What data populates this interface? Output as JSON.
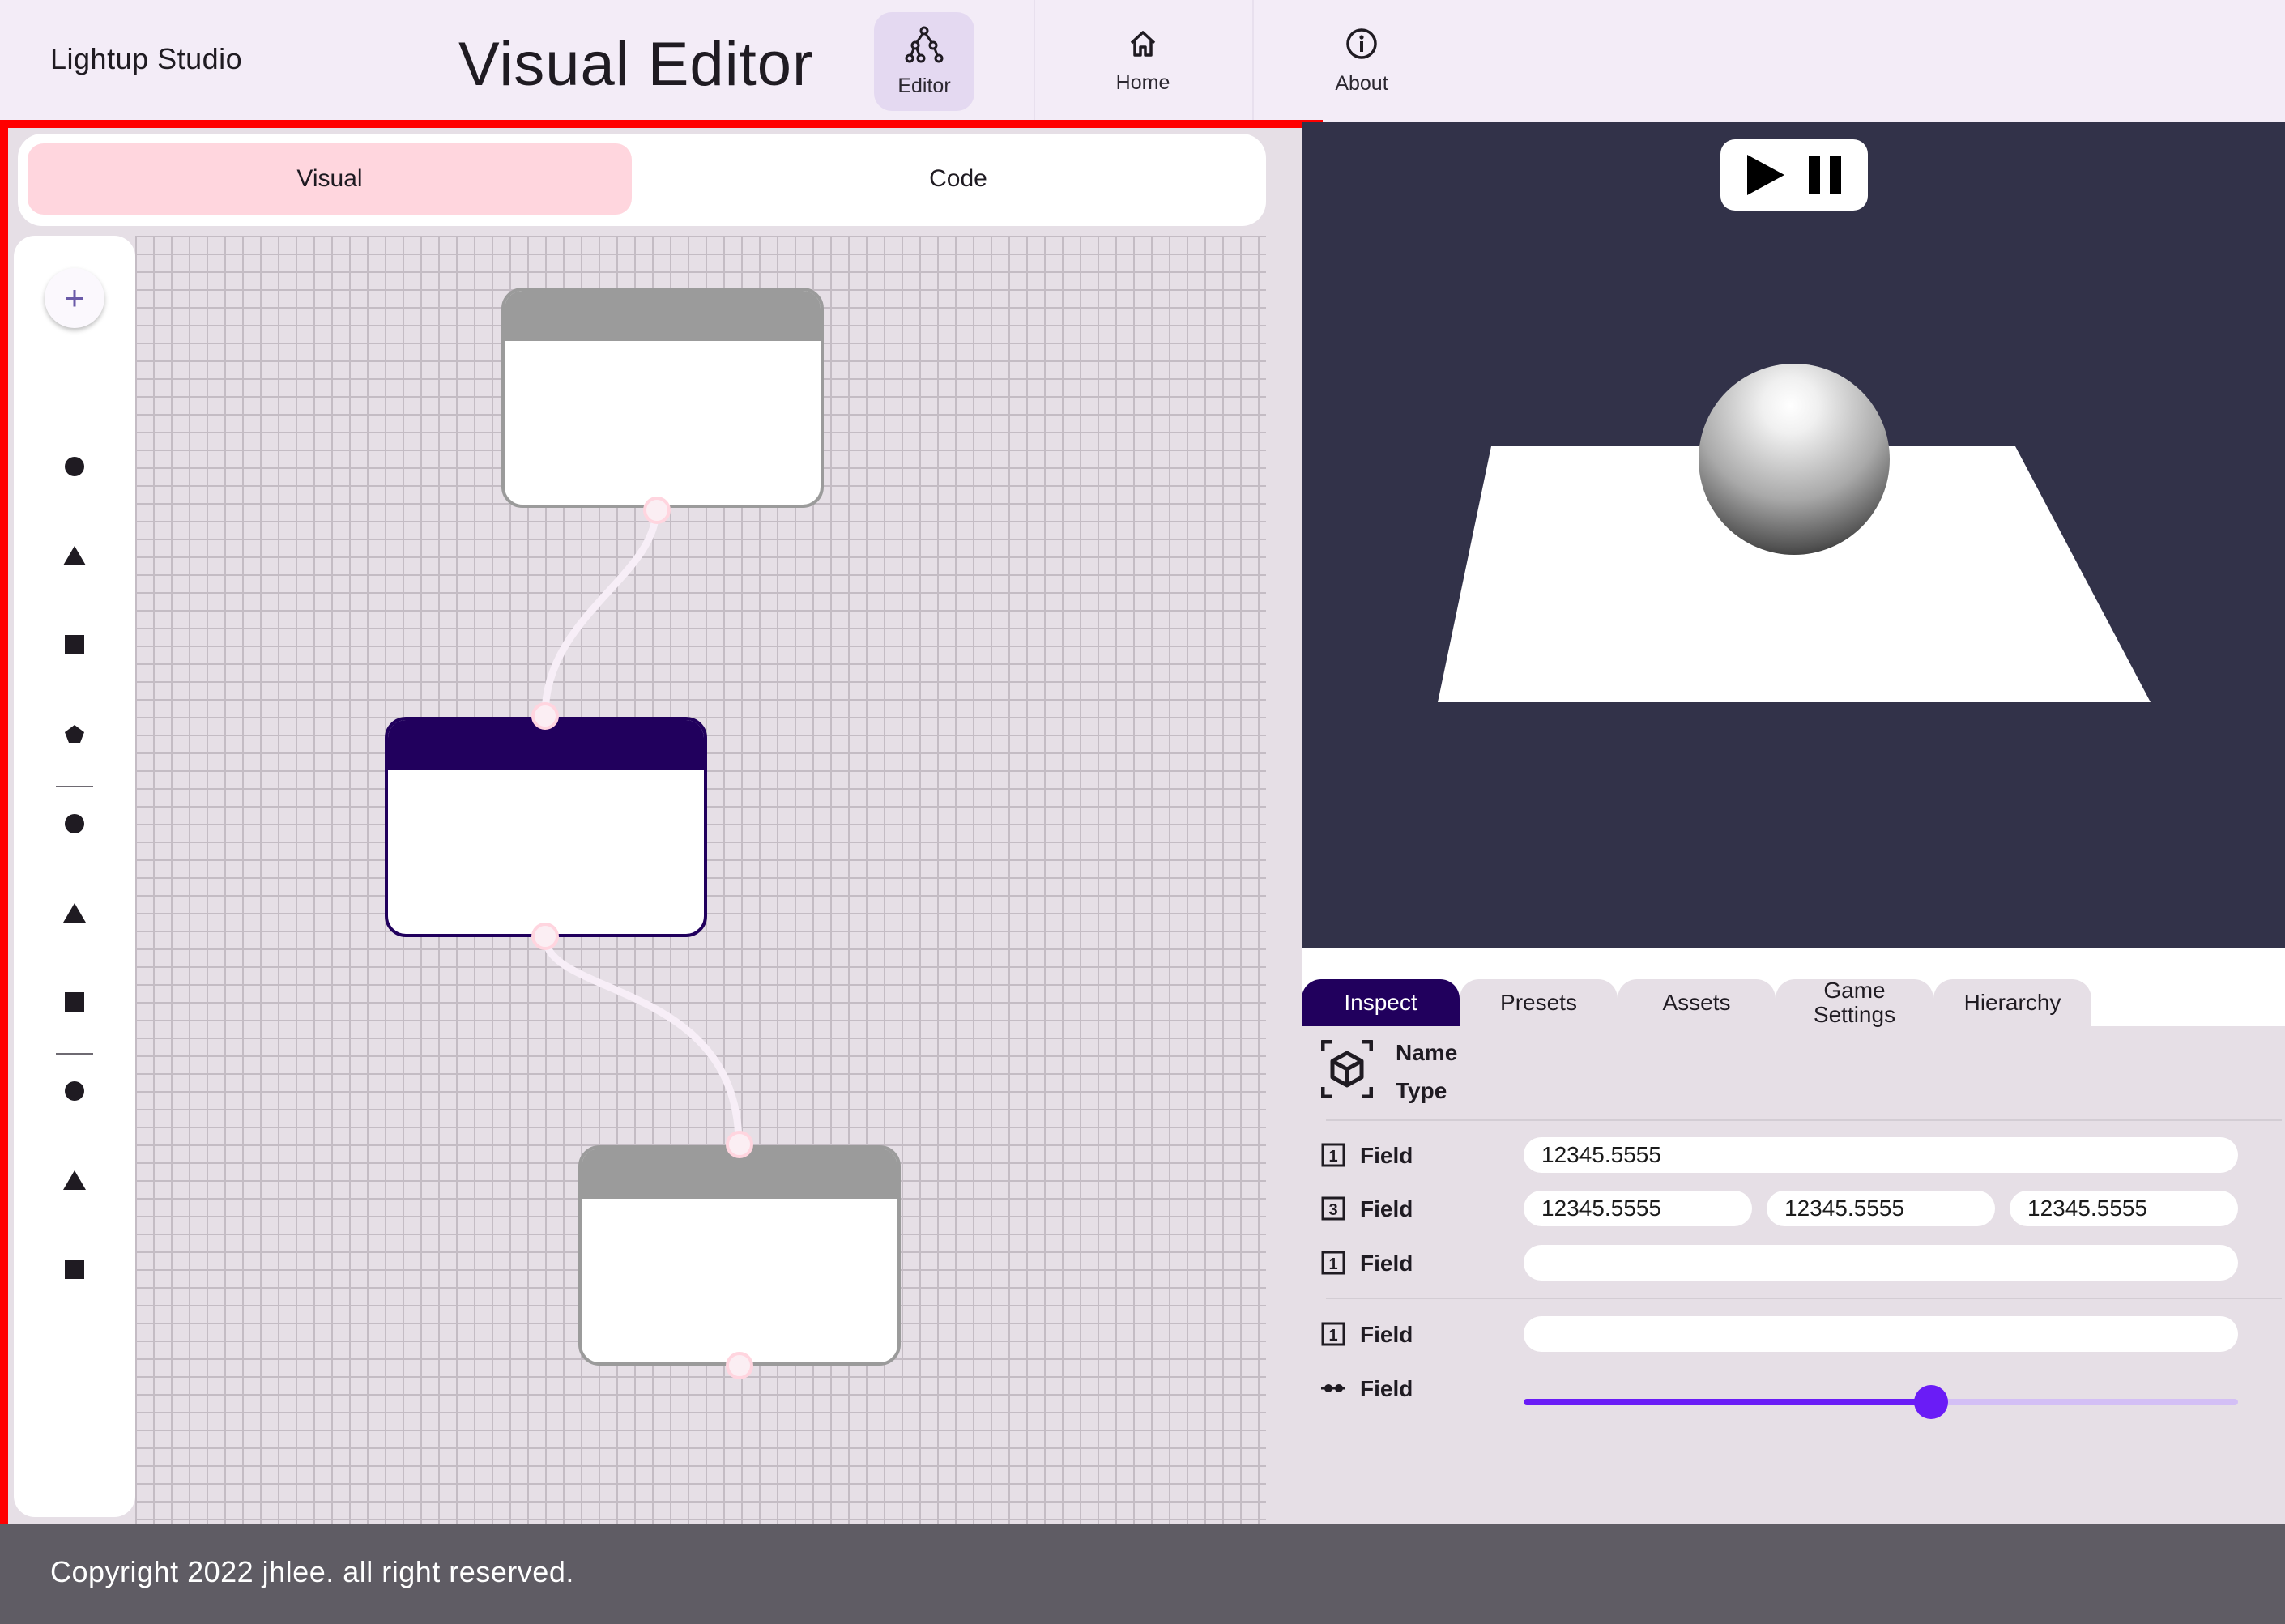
{
  "app": {
    "name": "Lightup Studio",
    "page_title": "Visual Editor"
  },
  "nav": [
    {
      "label": "Editor",
      "icon": "node-graph-icon",
      "active": true
    },
    {
      "label": "Home",
      "icon": "home-icon",
      "active": false
    },
    {
      "label": "About",
      "icon": "info-icon",
      "active": false
    }
  ],
  "editor": {
    "modes": [
      {
        "label": "Visual",
        "active": true
      },
      {
        "label": "Code",
        "active": false
      }
    ],
    "add_button": "+",
    "toolbox_groups": [
      [
        "circle-icon",
        "triangle-icon",
        "square-icon",
        "pentagon-icon"
      ],
      [
        "circle-icon",
        "triangle-icon",
        "square-icon"
      ],
      [
        "circle-icon",
        "triangle-icon",
        "square-icon"
      ]
    ],
    "nodes": [
      {
        "state": "default"
      },
      {
        "state": "selected"
      },
      {
        "state": "default"
      }
    ]
  },
  "viewport": {
    "controls": [
      "play-icon",
      "pause-icon"
    ],
    "objects": [
      "plane",
      "sphere"
    ]
  },
  "inspector": {
    "tabs": [
      "Inspect",
      "Presets",
      "Assets",
      "Game\nSettings",
      "Hierarchy"
    ],
    "active_tab": "Inspect",
    "object": {
      "name_label": "Name",
      "type_label": "Type",
      "icon": "cube-icon"
    },
    "fields": [
      {
        "icon": "one-icon",
        "label": "Field",
        "values": [
          "12345.5555"
        ]
      },
      {
        "icon": "three-icon",
        "label": "Field",
        "values": [
          "12345.5555",
          "12345.5555",
          "12345.5555"
        ]
      },
      {
        "icon": "one-icon",
        "label": "Field",
        "values": [
          ""
        ]
      },
      {
        "icon": "one-icon",
        "label": "Field",
        "values": [
          ""
        ]
      },
      {
        "icon": "slider-icon",
        "label": "Field",
        "slider_value": 0.57
      }
    ]
  },
  "colors": {
    "primary": "#21005d",
    "accent": "#6a1cf6",
    "surface": "#f3ecf7",
    "viewport_bg": "#323249",
    "selection_frame": "#ff0000",
    "pill_active": "#ffd6de"
  },
  "footer": {
    "text": "Copyright 2022 jhlee. all right reserved."
  }
}
